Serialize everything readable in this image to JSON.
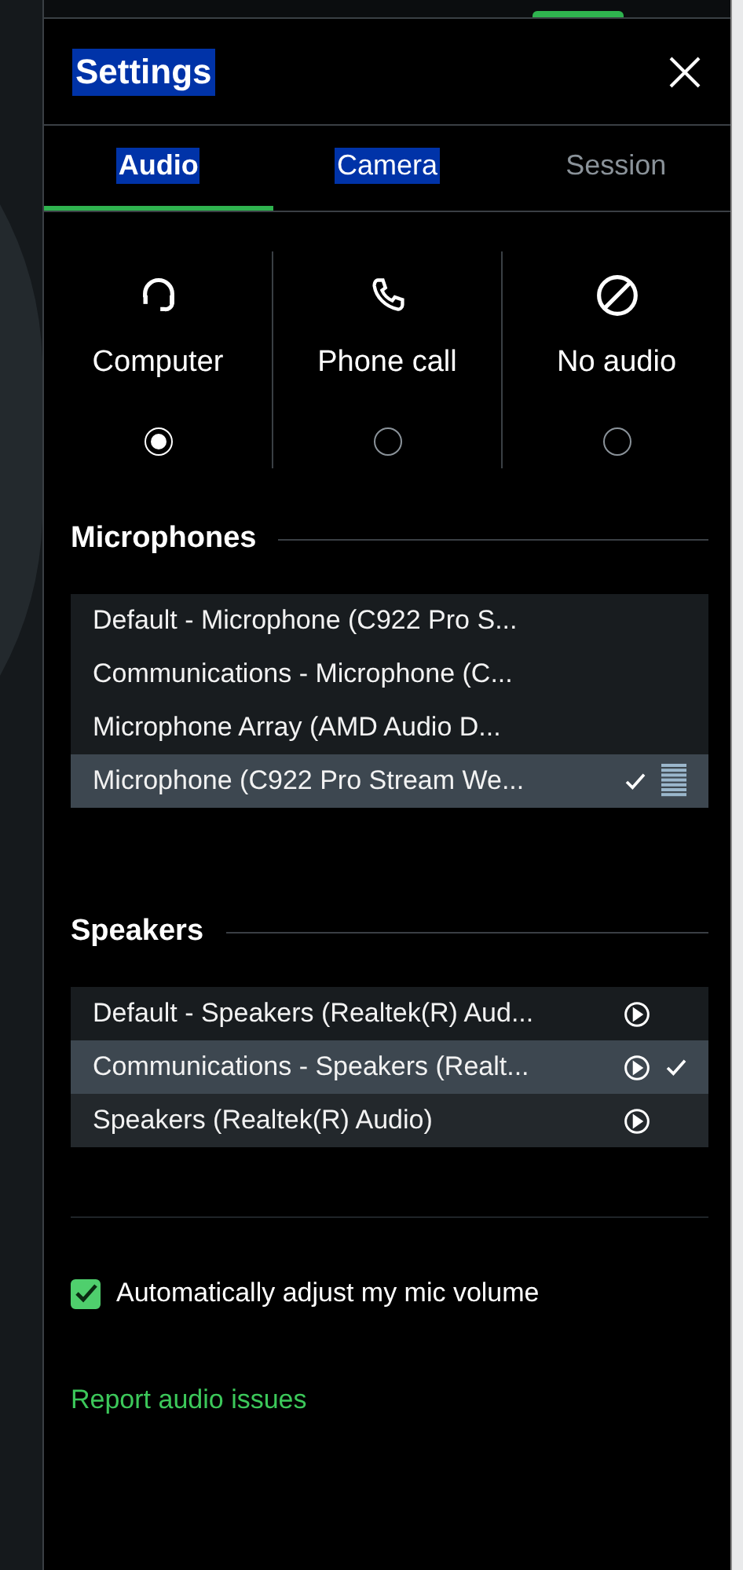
{
  "window": {
    "title": "Settings",
    "title_highlighted": true
  },
  "tabs": [
    {
      "label": "Audio",
      "selected": true,
      "highlighted": true
    },
    {
      "label": "Camera",
      "selected": false,
      "highlighted": true
    },
    {
      "label": "Session",
      "selected": false,
      "highlighted": false
    }
  ],
  "audio_modes": [
    {
      "kind": "headset",
      "label": "Computer",
      "selected": true
    },
    {
      "kind": "phone",
      "label": "Phone call",
      "selected": false
    },
    {
      "kind": "none",
      "label": "No audio",
      "selected": false
    }
  ],
  "device_sections": [
    {
      "kind": "input",
      "title": "Microphones",
      "devices": [
        {
          "name": "Default - Microphone (C922 Pro S...",
          "selected": false
        },
        {
          "name": "Communications - Microphone (C...",
          "selected": false
        },
        {
          "name": "Microphone Array (AMD Audio D...",
          "selected": false
        },
        {
          "name": "Microphone (C922 Pro Stream We...",
          "selected": true
        }
      ]
    },
    {
      "kind": "output",
      "title": "Speakers",
      "devices": [
        {
          "name": "Default - Speakers (Realtek(R) Aud...",
          "selected": false
        },
        {
          "name": "Communications - Speakers (Realt...",
          "selected": true
        },
        {
          "name": "Speakers (Realtek(R) Audio)",
          "selected": false
        }
      ]
    }
  ],
  "auto_adjust": {
    "label": "Automatically adjust my mic volume",
    "checked": true
  },
  "report_link": "Report audio issues"
}
